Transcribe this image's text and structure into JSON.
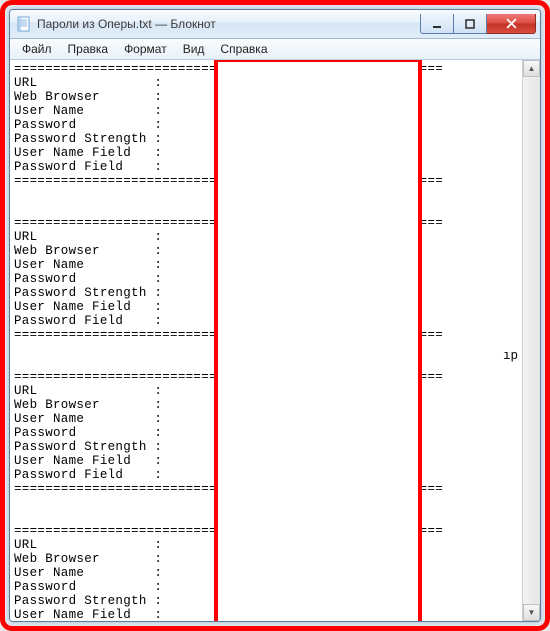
{
  "window": {
    "title": "Пароли из Оперы.txt — Блокнот"
  },
  "menu": {
    "items": [
      "Файл",
      "Правка",
      "Формат",
      "Вид",
      "Справка"
    ]
  },
  "content": {
    "separator_char": "=",
    "field_labels": [
      "URL",
      "Web Browser",
      "User Name",
      "Password",
      "Password Strength",
      "User Name Field",
      "Password Field"
    ],
    "partial_block_labels": [
      "URL",
      "Web Browser"
    ],
    "extra_fragment": "ıp"
  },
  "redaction_box": {
    "comment": "white redaction rectangle covering values column"
  }
}
